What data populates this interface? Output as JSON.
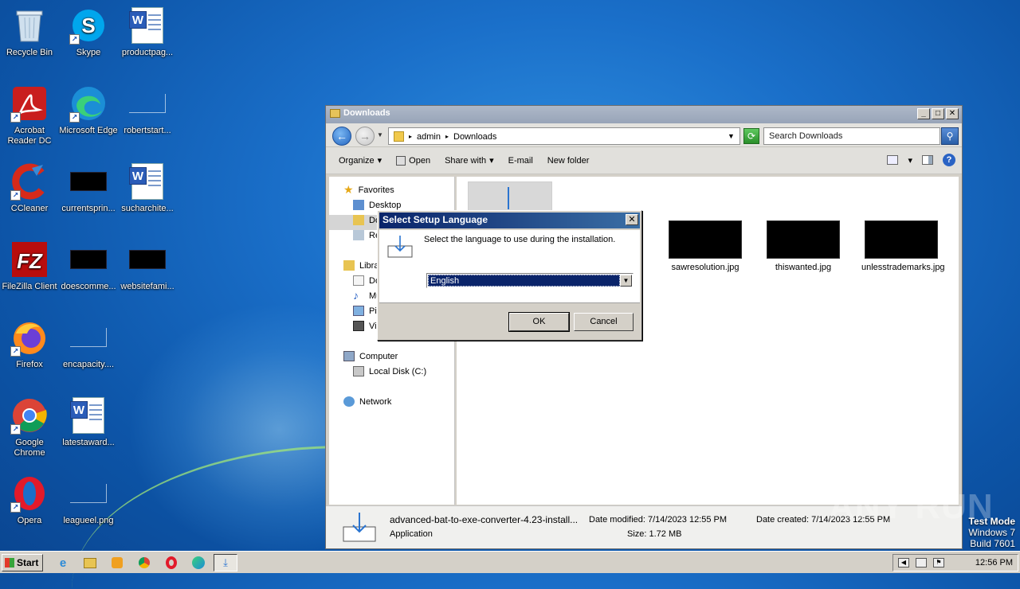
{
  "desktop": {
    "icons": [
      {
        "label": "Recycle Bin",
        "icon": "recycle-bin-icon"
      },
      {
        "label": "Skype",
        "icon": "skype-icon"
      },
      {
        "label": "productpag...",
        "icon": "word-document-icon"
      },
      {
        "label": "Acrobat Reader DC",
        "icon": "acrobat-reader-icon"
      },
      {
        "label": "Microsoft Edge",
        "icon": "edge-icon"
      },
      {
        "label": "robertstart...",
        "icon": "blank-file-icon"
      },
      {
        "label": "CCleaner",
        "icon": "ccleaner-icon"
      },
      {
        "label": "currentsprin...",
        "icon": "black-image-icon"
      },
      {
        "label": "sucharchite...",
        "icon": "word-document-icon"
      },
      {
        "label": "FileZilla Client",
        "icon": "filezilla-icon"
      },
      {
        "label": "doescomme...",
        "icon": "black-image-icon"
      },
      {
        "label": "websitefami...",
        "icon": "black-image-icon"
      },
      {
        "label": "Firefox",
        "icon": "firefox-icon"
      },
      {
        "label": "encapacity....",
        "icon": "blank-file-icon"
      },
      {
        "label": "Google Chrome",
        "icon": "chrome-icon"
      },
      {
        "label": "latestaward...",
        "icon": "word-document-icon"
      },
      {
        "label": "Opera",
        "icon": "opera-icon"
      },
      {
        "label": "leagueel.png",
        "icon": "blank-file-icon"
      }
    ]
  },
  "explorer": {
    "title": "Downloads",
    "address": {
      "crumbs": [
        "admin",
        "Downloads"
      ]
    },
    "search_placeholder": "Search Downloads",
    "toolbar": {
      "organize": "Organize",
      "open": "Open",
      "share_with": "Share with",
      "email": "E-mail",
      "new_folder": "New folder"
    },
    "nav": {
      "favorites": "Favorites",
      "desktop": "Desktop",
      "downloads": "Do",
      "recent": "Re",
      "libraries": "Libra",
      "documents": "Do",
      "music": "Mu",
      "pictures": "Pi",
      "videos": "Vi",
      "computer": "Computer",
      "local_disk": "Local Disk (C:)",
      "network": "Network"
    },
    "files": [
      {
        "name": "sawresolution.jpg"
      },
      {
        "name": "thiswanted.jpg"
      },
      {
        "name": "unlesstrademarks.jpg"
      }
    ],
    "details": {
      "filename": "advanced-bat-to-exe-converter-4.23-install...",
      "type": "Application",
      "date_modified": "Date modified: 7/14/2023 12:55 PM",
      "size": "Size: 1.72 MB",
      "date_created": "Date created: 7/14/2023 12:55 PM"
    }
  },
  "dialog": {
    "title": "Select Setup Language",
    "message": "Select the language to use during the installation.",
    "selected_language": "English",
    "ok": "OK",
    "cancel": "Cancel"
  },
  "watermark": {
    "text": "ANY RUN"
  },
  "testmode": {
    "line1": "Test Mode",
    "line2": "Windows 7",
    "line3": "Build 7601"
  },
  "taskbar": {
    "start": "Start",
    "clock": "12:56 PM"
  }
}
